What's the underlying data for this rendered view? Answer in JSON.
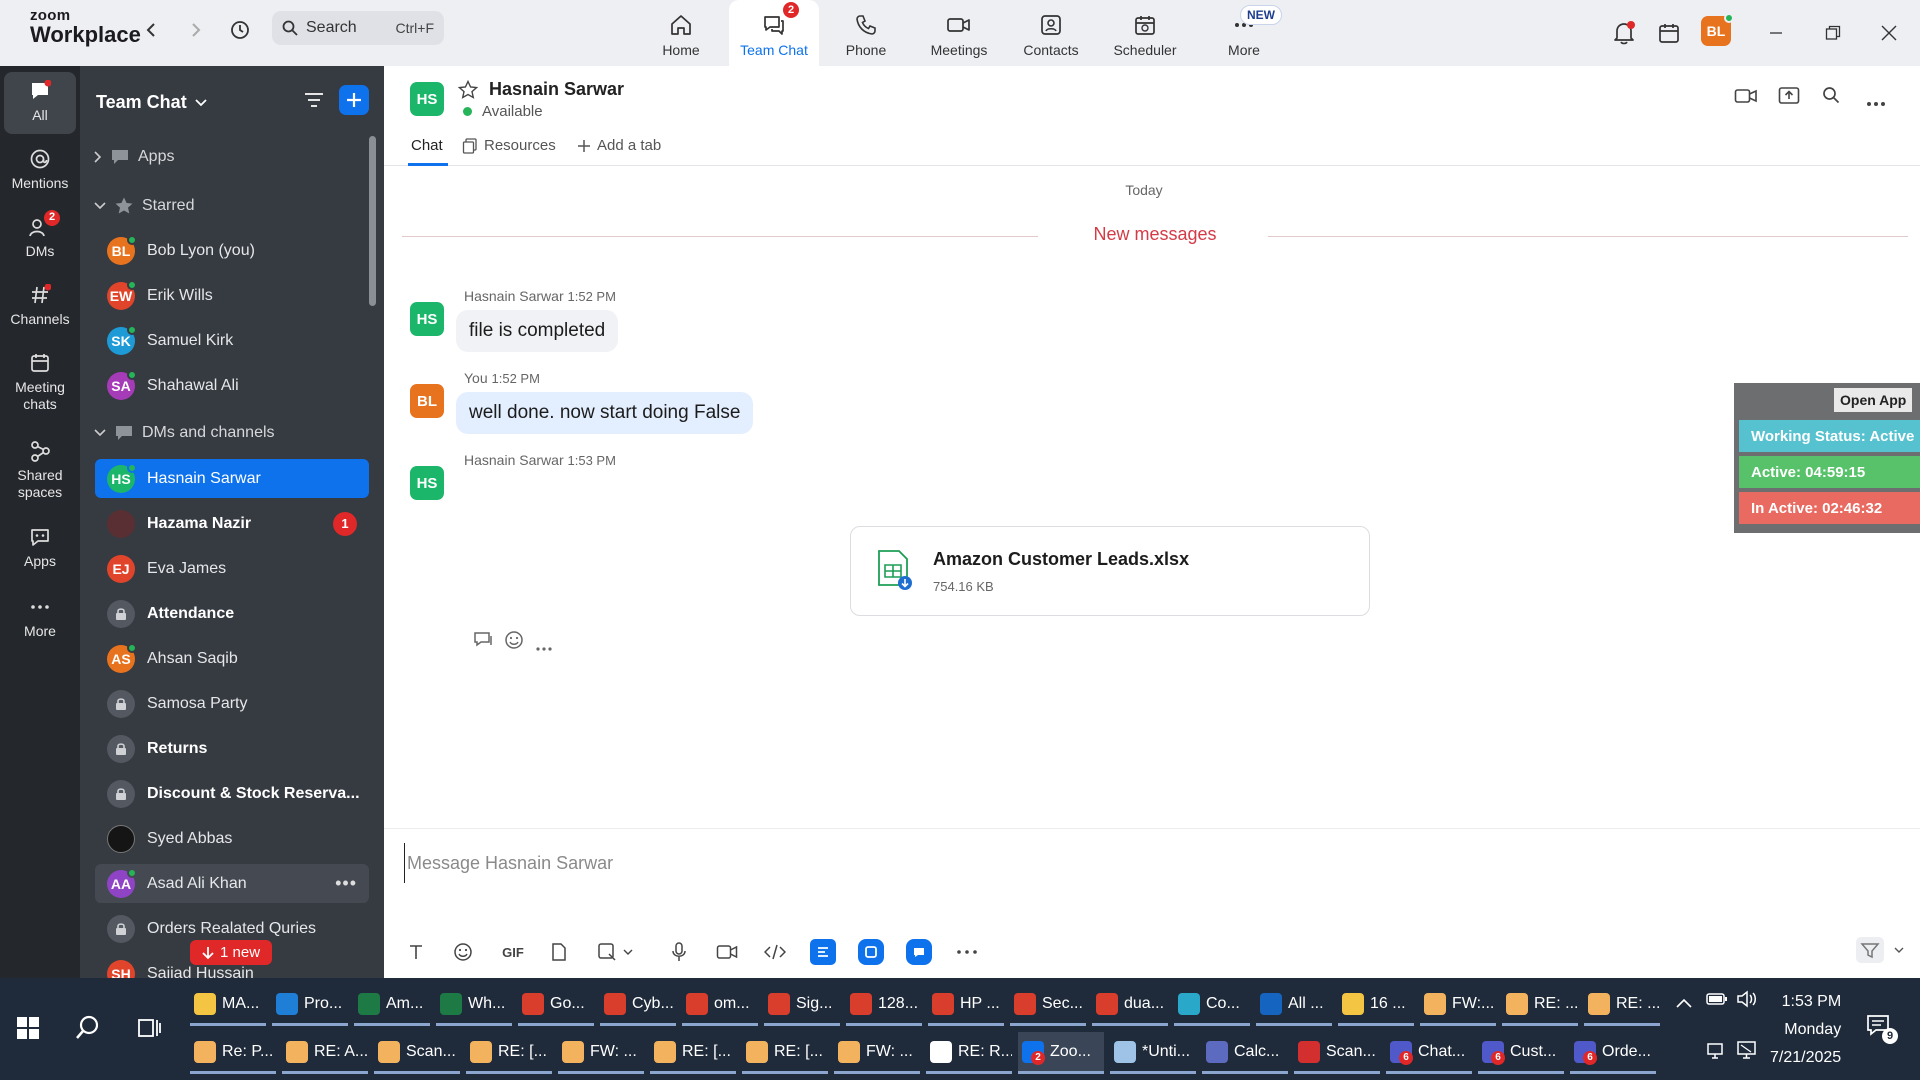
{
  "app": {
    "logo_line1": "zoom",
    "logo_line2": "Workplace",
    "search_label": "Search",
    "search_shortcut": "Ctrl+F"
  },
  "top_tabs": [
    {
      "label": "Home",
      "icon": "home-icon"
    },
    {
      "label": "Team Chat",
      "icon": "team-chat-icon",
      "badge": "2",
      "active": true
    },
    {
      "label": "Phone",
      "icon": "phone-icon"
    },
    {
      "label": "Meetings",
      "icon": "meetings-icon"
    },
    {
      "label": "Contacts",
      "icon": "contacts-icon"
    },
    {
      "label": "Scheduler",
      "icon": "scheduler-icon"
    },
    {
      "label": "More",
      "icon": "more-icon",
      "new_badge": "NEW"
    }
  ],
  "user_avatar": "BL",
  "rail": [
    {
      "label": "All",
      "active": true
    },
    {
      "label": "Mentions"
    },
    {
      "label": "DMs",
      "badge": "2"
    },
    {
      "label": "Channels"
    },
    {
      "label": "Meeting chats"
    },
    {
      "label": "Shared spaces"
    },
    {
      "label": "Apps"
    },
    {
      "label": "More"
    }
  ],
  "sidebar": {
    "title": "Team Chat",
    "sections": {
      "apps": "Apps",
      "starred": "Starred",
      "dms": "DMs and channels"
    },
    "starred": [
      {
        "initials": "BL",
        "name": "Bob Lyon (you)",
        "color": "#e8731e"
      },
      {
        "initials": "EW",
        "name": "Erik Wills",
        "color": "#e0452b"
      },
      {
        "initials": "SK",
        "name": "Samuel Kirk",
        "color": "#1e9bd7"
      },
      {
        "initials": "SA",
        "name": "Shahawal Ali",
        "color": "#a63bb8"
      }
    ],
    "dms": [
      {
        "initials": "HS",
        "name": "Hasnain Sarwar",
        "color": "#1cb66a",
        "selected": true
      },
      {
        "initials": "",
        "name": "Hazama Nazir",
        "color": "#4a2a2a",
        "bold": true,
        "unread": "1"
      },
      {
        "initials": "EJ",
        "name": "Eva James",
        "color": "#e0452b"
      },
      {
        "initials": "",
        "name": "Attendance",
        "lock": true,
        "bold": true
      },
      {
        "initials": "AS",
        "name": "Ahsan Saqib",
        "color": "#e8731e"
      },
      {
        "initials": "",
        "name": "Samosa Party",
        "lock": true
      },
      {
        "initials": "",
        "name": "Returns",
        "lock": true,
        "bold": true
      },
      {
        "initials": "",
        "name": "Discount & Stock Reserva...",
        "lock": true,
        "bold": true
      },
      {
        "initials": "",
        "name": "Syed Abbas",
        "color": "#111111"
      },
      {
        "initials": "AA",
        "name": "Asad Ali Khan",
        "color": "#8e44c4",
        "hover": true
      },
      {
        "initials": "",
        "name": "Orders Realated Quries",
        "lock": true
      },
      {
        "initials": "SH",
        "name": "Sajjad Hussain",
        "color": "#e0452b"
      }
    ],
    "new_pill": "1 new"
  },
  "chat": {
    "peer_initials": "HS",
    "peer_name": "Hasnain Sarwar",
    "peer_status": "Available",
    "tabs": {
      "chat": "Chat",
      "resources": "Resources",
      "add": "Add a tab"
    },
    "today": "Today",
    "new_messages": "New messages",
    "messages": [
      {
        "sender": "Hasnain Sarwar",
        "time": "1:52 PM",
        "initials": "HS",
        "text": "file is completed"
      },
      {
        "sender": "You",
        "time": "1:52 PM",
        "initials": "BL",
        "text": "well done. now start doing False"
      },
      {
        "sender": "Hasnain Sarwar",
        "time": "1:53 PM",
        "initials": "HS",
        "file_name": "Amazon Customer Leads.xlsx",
        "file_size": "754.16 KB"
      }
    ],
    "compose_placeholder": "Message Hasnain Sarwar",
    "gif_label": "GIF"
  },
  "status_widget": {
    "open_app": "Open App",
    "working": "Working Status: Active",
    "active": "Active: 04:59:15",
    "inactive": "In Active: 02:46:32"
  },
  "taskbar": {
    "row1": [
      {
        "label": "MA...",
        "color": "#f4c542"
      },
      {
        "label": "Pro...",
        "color": "#1f7fd6"
      },
      {
        "label": "Am...",
        "color": "#1d7a45"
      },
      {
        "label": "Wh...",
        "color": "#1d7a45"
      },
      {
        "label": "Go...",
        "color": "#d93d2b"
      },
      {
        "label": "Cyb...",
        "color": "#d93d2b"
      },
      {
        "label": "om...",
        "color": "#d93d2b"
      },
      {
        "label": "Sig...",
        "color": "#d93d2b"
      },
      {
        "label": "128...",
        "color": "#d93d2b"
      },
      {
        "label": "HP ...",
        "color": "#d93d2b"
      },
      {
        "label": "Sec...",
        "color": "#d93d2b"
      },
      {
        "label": "dua...",
        "color": "#d93d2b"
      },
      {
        "label": "Co...",
        "color": "#2aa8c9"
      },
      {
        "label": "All ...",
        "color": "#1565c0"
      },
      {
        "label": "16 ...",
        "color": "#f4c542"
      },
      {
        "label": "FW:...",
        "color": "#f3b35e"
      },
      {
        "label": "RE: ...",
        "color": "#f3b35e"
      },
      {
        "label": "RE: ...",
        "color": "#f3b35e"
      }
    ],
    "row2": [
      {
        "label": "Re: P...",
        "color": "#f3b35e"
      },
      {
        "label": "RE: A...",
        "color": "#f3b35e"
      },
      {
        "label": "Scan...",
        "color": "#f3b35e"
      },
      {
        "label": "RE: [...",
        "color": "#f3b35e"
      },
      {
        "label": "FW: ...",
        "color": "#f3b35e"
      },
      {
        "label": "RE: [...",
        "color": "#f3b35e"
      },
      {
        "label": "RE: [...",
        "color": "#f3b35e"
      },
      {
        "label": "FW: ...",
        "color": "#f3b35e"
      },
      {
        "label": "RE: R...",
        "color": "#ffffff"
      },
      {
        "label": "Zoo...",
        "color": "#0e72ed",
        "badge": "2"
      },
      {
        "label": "*Unti...",
        "color": "#9ec3e6"
      },
      {
        "label": "Calc...",
        "color": "#5c6bc0"
      },
      {
        "label": "Scan...",
        "color": "#d32f2f"
      },
      {
        "label": "Chat...",
        "color": "#5059c9",
        "badge": "6"
      },
      {
        "label": "Cust...",
        "color": "#5059c9",
        "badge": "6"
      },
      {
        "label": "Orde...",
        "color": "#5059c9",
        "badge": "6"
      }
    ],
    "time": "1:53 PM",
    "day": "Monday",
    "date": "7/21/2025",
    "notif_badge": "9"
  }
}
